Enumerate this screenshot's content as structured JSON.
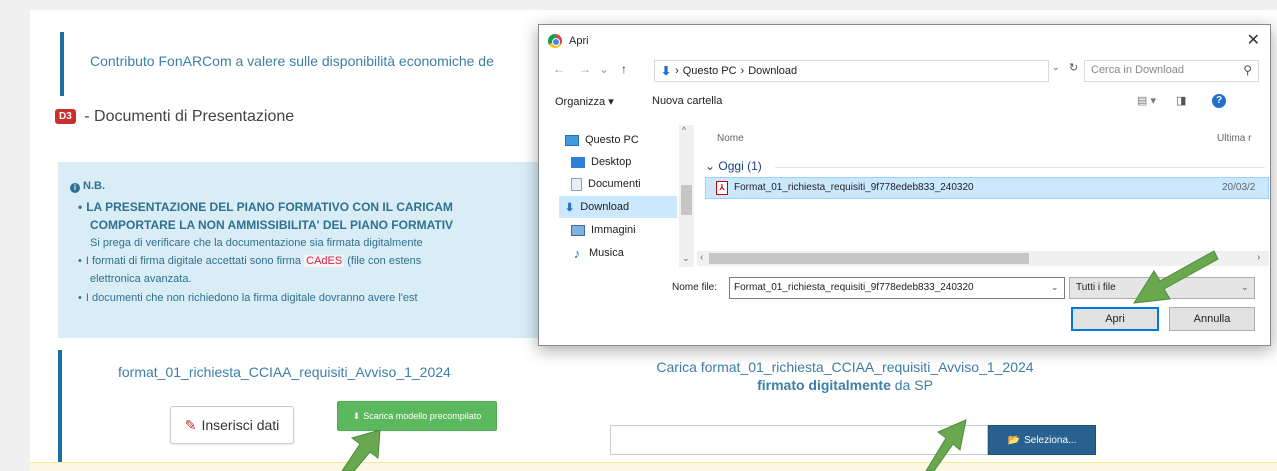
{
  "page": {
    "contributo_text": "Contributo FonARCom a valere sulle disponibilità economiche de",
    "section_badge": "D3",
    "section_title": "- Documenti di Presentazione",
    "nb": {
      "title": "N.B.",
      "bold_line1": "LA PRESENTAZIONE DEL PIANO FORMATIVO CON IL CARICAM",
      "bold_line2": "COMPORTARE LA NON AMMISSIBILITA' DEL PIANO FORMATIV",
      "line3": "Si prega di verificare che la documentazione sia firmata digitalmente",
      "line4_pre": "I formati di firma digitale accettati sono firma",
      "line4_tag": "CAdES",
      "line4_post": "(file con estens",
      "line5": "elettronica avanzata.",
      "line6": "I documenti che non richiedono la firma digitale dovranno avere l'est"
    },
    "doc_left_name": "format_01_richiesta_CCIAA_requisiti_Avviso_1_2024",
    "btn_inserisci": "Inserisci dati",
    "btn_scarica": "Scarica modello precompilato",
    "doc_right_line1": "Carica format_01_richiesta_CCIAA_requisiti_Avviso_1_2024",
    "doc_right_bold": "firmato digitalmente",
    "doc_right_suffix": "da SP",
    "btn_seleziona": "Seleziona..."
  },
  "dialog": {
    "title": "Apri",
    "breadcrumb": [
      "Questo PC",
      "Download"
    ],
    "search_placeholder": "Cerca in Download",
    "cmd_organizza": "Organizza ▾",
    "cmd_nuova": "Nuova cartella",
    "nav_items": [
      "Questo PC",
      "Desktop",
      "Documenti",
      "Download",
      "Immagini",
      "Musica"
    ],
    "col_nome": "Nome",
    "col_ultima": "Ultima r",
    "group_label": "Oggi (1)",
    "file_name": "Format_01_richiesta_requisiti_9f778edeb833_240320",
    "file_date": "20/03/2",
    "nome_file_label": "Nome file:",
    "nome_file_value": "Format_01_richiesta_requisiti_9f778edeb833_240320",
    "filter_value": "Tutti i file",
    "btn_apri": "Apri",
    "btn_annulla": "Annulla"
  },
  "colors": {
    "arrow_green": "#6aa84f",
    "accent_blue": "#0078d7",
    "success_green": "#5cb85c",
    "primary_blue": "#286090"
  }
}
